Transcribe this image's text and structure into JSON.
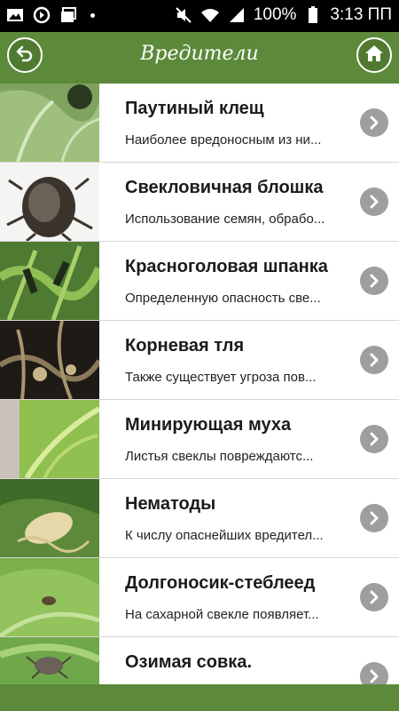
{
  "statusbar": {
    "battery": "100%",
    "time": "3:13 ПП",
    "icons": [
      "image-icon",
      "data-saver-icon",
      "gallery-icon",
      "mute-icon",
      "wifi-icon",
      "signal-icon",
      "battery-icon"
    ]
  },
  "header": {
    "title": "Вредители",
    "back_icon": "back-arrow-icon",
    "home_icon": "home-icon"
  },
  "colors": {
    "header_green": "#5c8a3a",
    "chevron_gray": "#9e9e9e"
  },
  "items": [
    {
      "title": "Паутиный клещ",
      "subtitle": "Наиболее вредоносным из ни..."
    },
    {
      "title": "Свекловичная блошка",
      "subtitle": "Использование семян, обрабо..."
    },
    {
      "title": "Красноголовая шпанка",
      "subtitle": "Определенную опасность све..."
    },
    {
      "title": "Корневая тля",
      "subtitle": "Также существует угроза пов..."
    },
    {
      "title": "Минирующая муха",
      "subtitle": "Листья свеклы повреждаютс..."
    },
    {
      "title": "Нематоды",
      "subtitle": "К числу опаснейших вредител..."
    },
    {
      "title": "Долгоносик-стеблеед",
      "subtitle": "На сахарной свекле появляет..."
    },
    {
      "title": "Озимая совка.",
      "subtitle": ""
    }
  ]
}
